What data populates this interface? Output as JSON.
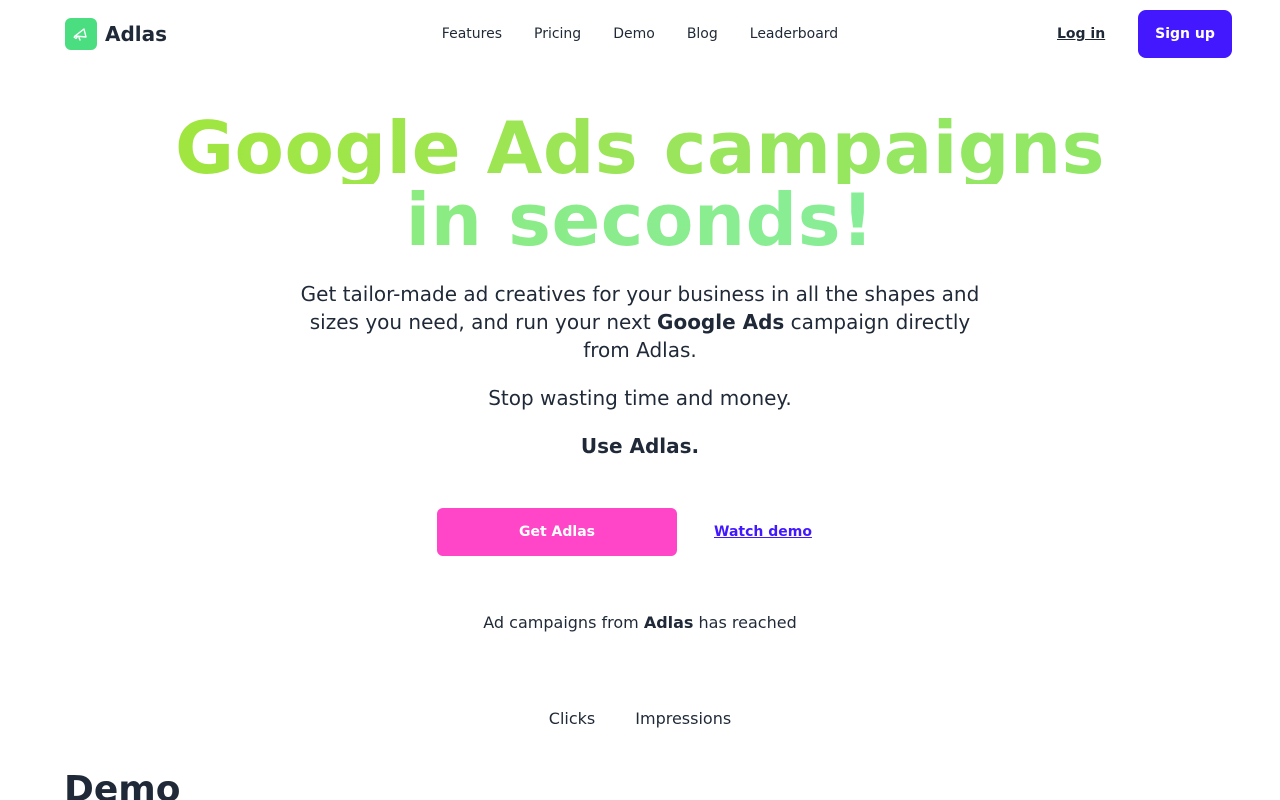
{
  "header": {
    "brand_name": "Adlas",
    "nav": [
      "Features",
      "Pricing",
      "Demo",
      "Blog",
      "Leaderboard"
    ],
    "login_label": "Log in",
    "signup_label": "Sign up"
  },
  "hero": {
    "title_line1": "Google Ads campaigns",
    "title_line2": "in seconds!",
    "lead_part1": "Get tailor-made ad creatives for your business in all the shapes and sizes you need, and run your next ",
    "lead_bold": "Google Ads",
    "lead_part2": " campaign directly from Adlas.",
    "stop_text": "Stop wasting time and money.",
    "use_text": "Use Adlas.",
    "cta_label": "Get Adlas",
    "watch_label": "Watch demo"
  },
  "reach": {
    "prefix": "Ad campaigns from ",
    "brand": "Adlas",
    "suffix": " has reached"
  },
  "stats": {
    "clicks_label": "Clicks",
    "impressions_label": "Impressions"
  },
  "demo": {
    "heading": "Demo"
  },
  "colors": {
    "brand_logo": "#4ade80",
    "signup": "#4318ff",
    "cta": "#ff45c8",
    "title_green_1": "#a3e635",
    "title_green_2": "#86efac"
  },
  "icons": {
    "logo": "megaphone-icon"
  }
}
